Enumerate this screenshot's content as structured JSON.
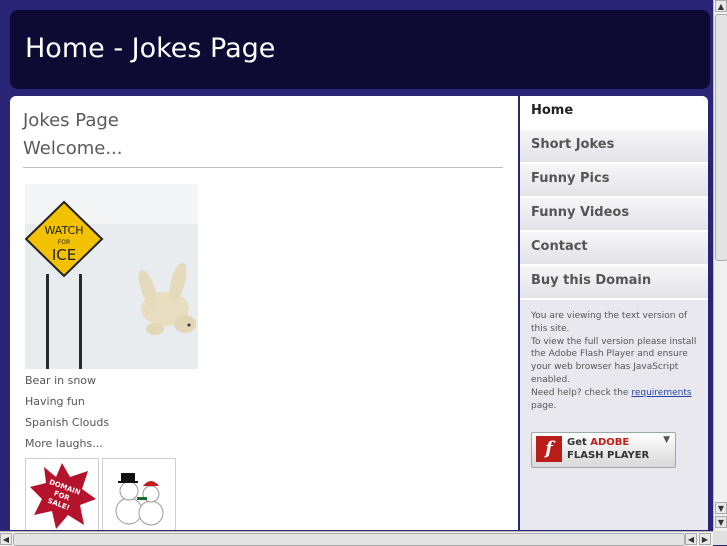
{
  "header": {
    "title": "Home - Jokes Page"
  },
  "main": {
    "heading": "Jokes Page",
    "subheading": "Welcome...",
    "photo": {
      "sign_line1": "WATCH",
      "sign_line2": "FOR",
      "sign_line3": "ICE"
    },
    "links": [
      "Bear in snow",
      "Having fun",
      "Spanish Clouds",
      "More laughs..."
    ],
    "thumb1": {
      "text_line1": "DOMAIN",
      "text_line2": "FOR",
      "text_line3": "SALE!"
    }
  },
  "sidebar": {
    "nav": [
      "Home",
      "Short Jokes",
      "Funny Pics",
      "Funny Videos",
      "Contact",
      "Buy this Domain"
    ],
    "text": {
      "line1": "You are viewing the text version of this site.",
      "line2": "To view the full version please install the Adobe Flash Player and ensure your web browser has JavaScript enabled.",
      "line3_prefix": "Need help? check the ",
      "line3_link": "requirements",
      "line3_suffix": " page."
    },
    "flash_badge": {
      "get": "Get ",
      "adobe": "ADOBE",
      "product": "FLASH",
      "player": " PLAYER"
    }
  },
  "colors": {
    "background": "#2a2477",
    "header": "#0d0b33",
    "flash_red": "#b81d18"
  },
  "icons": [
    "flash-logo-icon",
    "download-arrow-icon",
    "scroll-up-icon",
    "scroll-down-icon",
    "scroll-left-icon",
    "scroll-right-icon"
  ]
}
